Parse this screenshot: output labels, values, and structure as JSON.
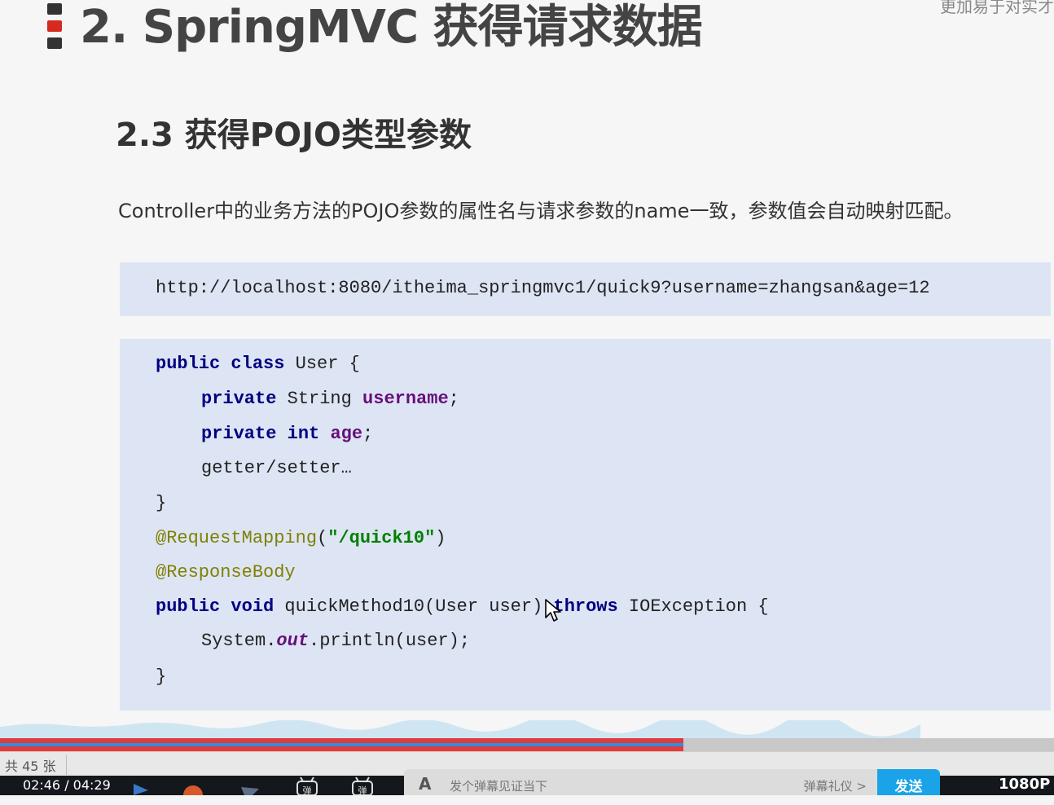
{
  "slide": {
    "heading_main": "2. SpringMVC 获得请求数据",
    "heading_sub": "2.3 获得POJO类型参数",
    "description": "Controller中的业务方法的POJO参数的属性名与请求参数的name一致，参数值会自动映射匹配。",
    "url": "http://localhost:8080/itheima_springmvc1/quick9?username=zhangsan&age=12",
    "corner_fragment": "更加易于对实才"
  },
  "code": {
    "l1_kw": "public class",
    "l1_rest": " User {",
    "l2_kw": "private",
    "l2_mid": " String ",
    "l2_field": "username",
    "l2_end": ";",
    "l3_kw": "private int",
    "l3_sp": " ",
    "l3_field": "age",
    "l3_end": ";",
    "l4": "getter/setter…",
    "l5": "}",
    "l6_ann": "@RequestMapping",
    "l6_open": "(",
    "l6_str": "\"/quick10\"",
    "l6_close": ")",
    "l7_ann": "@ResponseBody",
    "l8_kw1": "public void",
    "l8_mid": " quickMethod10(User user) ",
    "l8_kw2": "throws",
    "l8_end": " IOException {",
    "l9_pre": "System.",
    "l9_static": "out",
    "l9_post": ".println(user);",
    "l10": "}"
  },
  "status": {
    "slide_count": "共 45 张"
  },
  "player": {
    "time_current": "02:46",
    "time_sep": " / ",
    "time_total": "04:29",
    "progress_fraction": 0.648,
    "danmaku_icon_label": "A",
    "danmaku_placeholder": "发个弹幕见证当下",
    "danmaku_etiquette": "弹幕礼仪 >",
    "send_label": "发送",
    "quality_label": "1080P"
  },
  "colors": {
    "keyword": "#000080",
    "field": "#660e7a",
    "annotation": "#808000",
    "string": "#008000",
    "code_background": "#dde5f4",
    "progress_red": "#e23b3b",
    "send_button": "#1aa3e8"
  }
}
